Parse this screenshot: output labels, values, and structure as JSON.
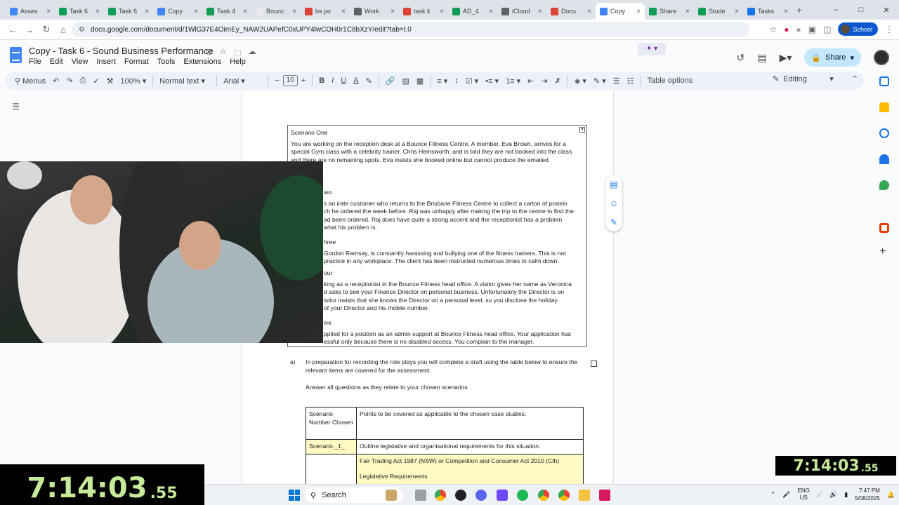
{
  "browser": {
    "tabs": [
      {
        "label": "Asses",
        "color": "#4285f4"
      },
      {
        "label": "Task 6",
        "color": "#0f9d58"
      },
      {
        "label": "Task 6",
        "color": "#0f9d58"
      },
      {
        "label": "Copy",
        "color": "#4285f4"
      },
      {
        "label": "Task 4",
        "color": "#0f9d58"
      },
      {
        "label": "Bounc",
        "color": "#e8eaed"
      },
      {
        "label": "bs po",
        "color": "#db4437"
      },
      {
        "label": "Work",
        "color": "#5f6368"
      },
      {
        "label": "task li",
        "color": "#db4437"
      },
      {
        "label": "AD_4",
        "color": "#0f9d58"
      },
      {
        "label": "iCloud",
        "color": "#5f6368"
      },
      {
        "label": "Docu",
        "color": "#db4437"
      },
      {
        "label": "Copy",
        "color": "#4285f4"
      },
      {
        "label": "Share",
        "color": "#0f9d58"
      },
      {
        "label": "Stude",
        "color": "#0f9d58"
      },
      {
        "label": "Tasks",
        "color": "#1a73e8"
      }
    ],
    "active_tab_index": 12,
    "url": "docs.google.com/document/d/1WlG37E4OimEy_NAW2UAPefC0xUPY4lwCOH0r1C8bXzY/edit?tab=t.0",
    "profile_label": "School"
  },
  "doc": {
    "title": "Copy - Task 6 - Sound Business Performance",
    "menus": [
      "File",
      "Edit",
      "View",
      "Insert",
      "Format",
      "Tools",
      "Extensions",
      "Help"
    ],
    "share_label": "Share"
  },
  "toolbar": {
    "menus_label": "Menus",
    "zoom": "100%",
    "style": "Normal text",
    "font": "Arial",
    "font_size": "10",
    "table_options": "Table options",
    "mode": "Editing",
    "text_color": "#202124",
    "highlight_color": "#fbbc04"
  },
  "scenarios": {
    "s1_title": "Scenario One",
    "s1_text": "You are working on the reception desk at a Bounce Fitness Centre. A member, Eva Brown, arrives for a special Gym class with a celebrity trainer, Chris Hemsworth, and is told they are not booked into the class and there are no remaining spots. Eva insists she booked online but cannot produce the emailed",
    "s2_title": "wo",
    "s2_text_1": "s an irate customer who returns to the Brisbane Fitness Centre to collect a carton of protein",
    "s2_text_2": "ch he ordered the week before. Raj was unhappy after making the trip to the centre to find the",
    "s2_text_3": "ad been ordered. Raj does have quite a strong accent and the receptionist has a problem",
    "s2_text_4": "what his problem is.",
    "s3_title": "hree",
    "s3_text_1": "Gordon Ramsay, is constantly harassing and bullying one of the fitness trainers. This is not",
    "s3_text_2": "practice in any workplace. The client has been instructed numerous times to calm down.",
    "s4_title": "our",
    "s4_text_1": "king as a receptionist in the Bounce Fitness head office. A visitor gives her name as Veronica",
    "s4_text_2": "d asks to see your Finance Director on personal business. Unfortunately the Director is on",
    "s4_text_3": "isitor insists that she knows the Director on a personal level, so you disclose the holiday",
    "s4_text_4": "of your Director and his mobile number.",
    "s5_title": "ive",
    "s5_text_1": "pplied for a position as an admin support at Bounce Fitness head office. Your application has",
    "s5_text_2": "essful only because there is no disabled access. You complain to the manager."
  },
  "question": {
    "marker": "a)",
    "text": "In preparation for recording the role plays you will complete a draft using the table below to ensure the relevant items are covered for the assessment.",
    "note": "Answer all questions as they relate to your chosen scenarios"
  },
  "table": {
    "h1": "Scenario Number Chosen",
    "h2": "Points to be covered as applicable to the chosen case studies.",
    "r1c1": "Scenario _1_",
    "r1c2": "Outline legislative and organisational requirements for this situation.",
    "r2c2a": "Fair Trading Act 1987 (NSW) or Competition and Consumer Act 2010 (Cth)",
    "r2c2b": "Legislative Requirements"
  },
  "timer": {
    "main": "7:14:03",
    "fraction": ".55"
  },
  "taskbar": {
    "search": "Search",
    "lang_1": "ENG",
    "lang_2": "US",
    "time": "7:47 PM",
    "date": "5/08/2025"
  }
}
